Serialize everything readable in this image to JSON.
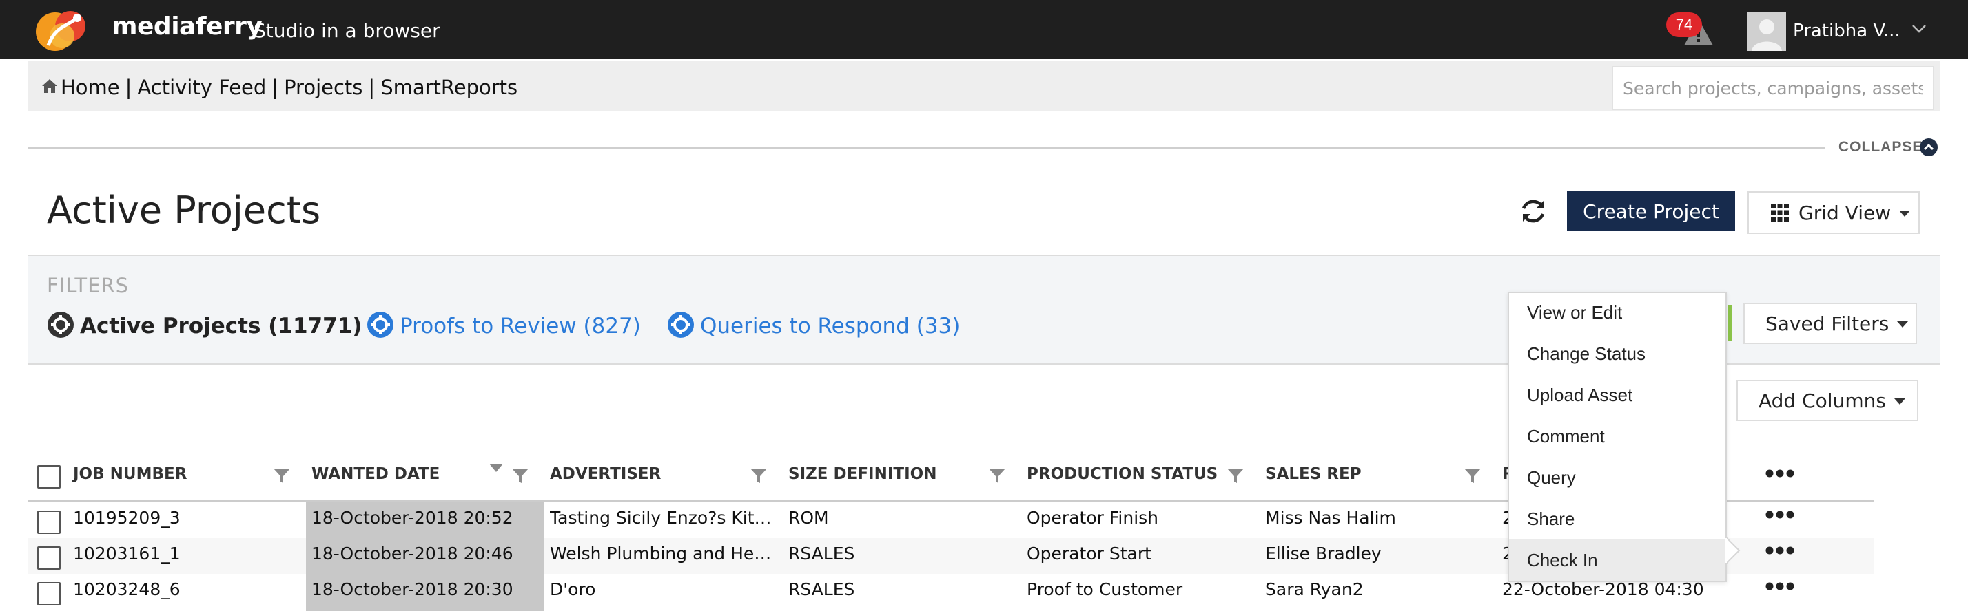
{
  "header": {
    "brand": "mediaferry",
    "tagline": "Studio in a browser",
    "alert_count": "74",
    "user_name": "Pratibha V..."
  },
  "nav": {
    "links": [
      "Home",
      "Activity Feed",
      "Projects",
      "SmartReports"
    ],
    "separator": "|",
    "search_placeholder": "Search projects, campaigns, assets"
  },
  "collapse_label": "COLLAPSE",
  "page": {
    "title": "Active Projects",
    "create_label": "Create Project",
    "view_label": "Grid View"
  },
  "filters": {
    "label": "FILTERS",
    "items": [
      {
        "label": "Active Projects (11771)"
      },
      {
        "label": "Proofs to Review (827)"
      },
      {
        "label": "Queries to Respond (33)"
      }
    ],
    "saved_label": "Saved Filters",
    "add_columns_label": "Add Columns"
  },
  "table": {
    "columns": [
      "JOB NUMBER",
      "WANTED DATE",
      "ADVERTISER",
      "SIZE DEFINITION",
      "PRODUCTION STATUS",
      "SALES REP",
      "R"
    ],
    "rows": [
      {
        "job": "10195209_3",
        "wanted": "18-October-2018 20:52",
        "advertiser": "Tasting Sicily Enzo?s Kitc...",
        "size": "ROM",
        "status": "Operator Finish",
        "rep": "Miss Nas Halim",
        "r": "2"
      },
      {
        "job": "10203161_1",
        "wanted": "18-October-2018 20:46",
        "advertiser": "Welsh Plumbing and Heat...",
        "size": "RSALES",
        "status": "Operator Start",
        "rep": "Ellise Bradley",
        "r": "2"
      },
      {
        "job": "10203248_6",
        "wanted": "18-October-2018 20:30",
        "advertiser": "D'oro",
        "size": "RSALES",
        "status": "Proof to Customer",
        "rep": "Sara Ryan2",
        "r": "22-October-2018 04:30"
      }
    ]
  },
  "context_menu": {
    "items": [
      "View or Edit",
      "Change Status",
      "Upload Asset",
      "Comment",
      "Query",
      "Share",
      "Check In"
    ],
    "active_index": 6
  },
  "colors": {
    "topbar": "#1f1f1f",
    "primary_button": "#172b4d",
    "link_blue": "#2a7ad8",
    "badge_red": "#e0262b",
    "saved_green": "#8bc34a"
  },
  "icons": {
    "alert": "warning-icon",
    "home": "home-icon",
    "refresh": "refresh-icon",
    "grid": "grid-icon",
    "filter": "funnel-icon",
    "gear": "gear-icon",
    "more": "ellipsis-icon"
  }
}
